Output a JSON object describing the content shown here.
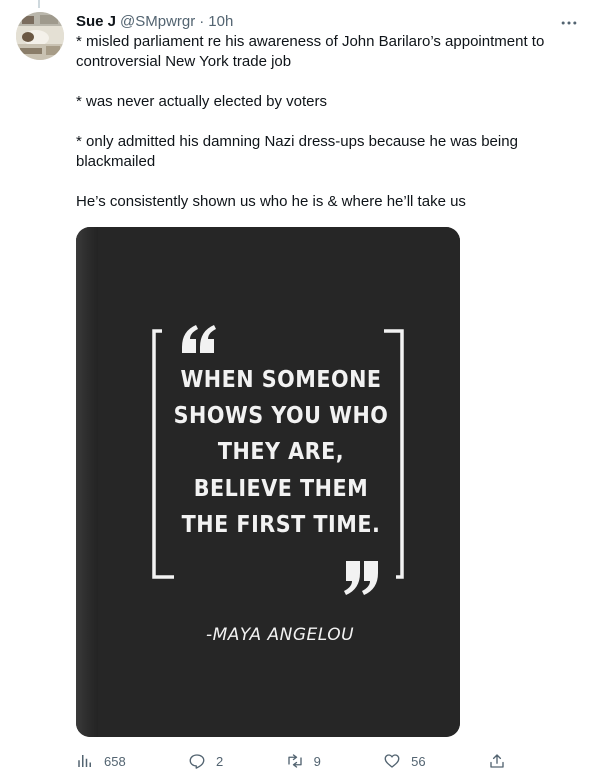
{
  "author": {
    "name": "Sue J",
    "handle": "@SMpwrgr",
    "separator": "·",
    "time": "10h"
  },
  "tweet": {
    "paragraphs": [
      "* misled parliament re his awareness of John Barilaro’s appointment to controversial New York trade job",
      "* was never actually elected by voters",
      "* only admitted his damning Nazi dress-ups because he was being blackmailed",
      "He’s consistently shown us who he is & where he’ll take us"
    ]
  },
  "image": {
    "quote_lines": [
      "WHEN SOMEONE",
      "SHOWS YOU WHO",
      "THEY ARE,",
      "BELIEVE THEM",
      "THE FIRST TIME."
    ],
    "attribution": "-MAYA ANGELOU",
    "background_color": "#262626",
    "text_color": "#f2f2f2"
  },
  "actions": {
    "views": {
      "icon": "views-chart-icon",
      "count": "658"
    },
    "replies": {
      "icon": "reply-bubble-icon",
      "count": "2"
    },
    "retweets": {
      "icon": "retweet-icon",
      "count": "9"
    },
    "likes": {
      "icon": "heart-icon",
      "count": "56"
    },
    "share": {
      "icon": "share-upload-icon"
    }
  },
  "menu": {
    "icon": "more-options-icon"
  }
}
